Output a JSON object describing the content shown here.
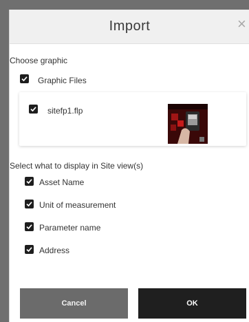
{
  "dialog": {
    "title": "Import",
    "close_glyph": "×",
    "choose_label": "Choose graphic",
    "graphic_files_label": "Graphic Files",
    "file": {
      "name": "sitefp1.flp",
      "checked": true
    },
    "display_label": "Select what to display in Site view(s)",
    "display_options": [
      {
        "label": "Asset Name",
        "checked": true
      },
      {
        "label": "Unit of measurement",
        "checked": true
      },
      {
        "label": "Parameter name",
        "checked": true
      },
      {
        "label": "Address",
        "checked": true
      }
    ],
    "cancel_label": "Cancel",
    "ok_label": "OK"
  },
  "icons": {
    "close": "close-icon",
    "checkbox": "checkmark-icon"
  },
  "colors": {
    "cancel_bg": "#6b6b6b",
    "ok_bg": "#1f1f1f",
    "header_bg": "#f0f0f0"
  }
}
